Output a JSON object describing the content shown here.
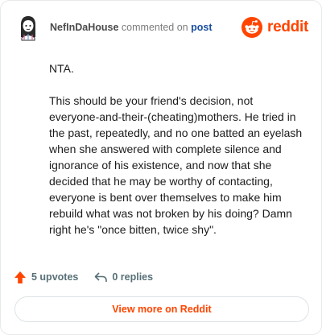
{
  "header": {
    "username": "NefInDaHouse",
    "verb": "commented on",
    "target_link": "post",
    "brand_name": "reddit",
    "brand_color": "#ff4500",
    "avatar_icon": "avatar-icon",
    "brand_icon": "reddit-snoo-icon"
  },
  "comment": {
    "paragraph_1": "NTA.",
    "paragraph_2": "This should be your friend's decision, not everyone-and-their-(cheating)mothers. He tried in the past, repeatedly, and no one batted an eyelash when she answered with complete silence and ignorance of his existence, and now that she decided that he may be worthy of contacting, everyone is bent over themselves to make him rebuild what was not broken by his doing? Damn right he's \"once bitten, twice shy\"."
  },
  "actions": {
    "upvotes_label": "5 upvotes",
    "replies_label": "0 replies",
    "upvote_icon": "upvote-arrow-icon",
    "reply_icon": "reply-icon",
    "upvote_color": "#ff4500"
  },
  "cta": {
    "label": "View more on Reddit"
  }
}
